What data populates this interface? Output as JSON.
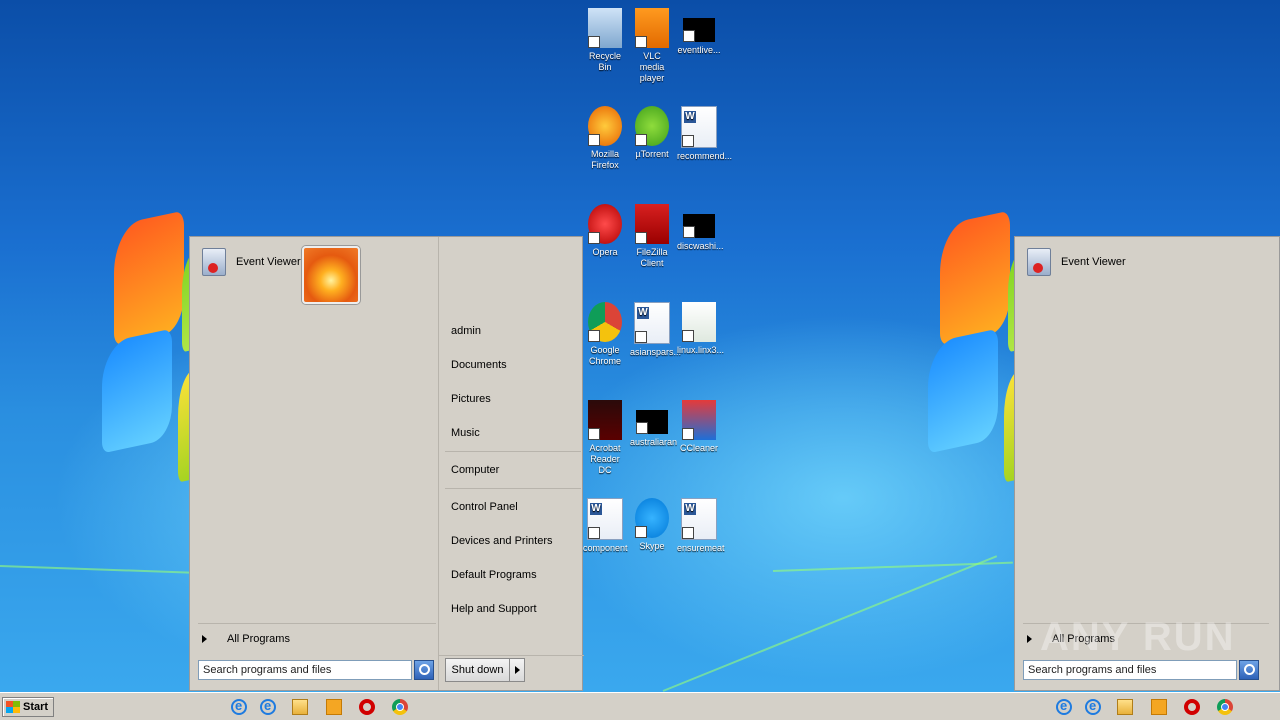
{
  "start_menu": {
    "pinned_program": "Event Viewer",
    "right_items": [
      "admin",
      "Documents",
      "Pictures",
      "Music",
      "Computer",
      "Control Panel",
      "Devices and Printers",
      "Default Programs",
      "Help and Support"
    ],
    "all_programs": "All Programs",
    "search_placeholder": "Search programs and files",
    "shutdown_label": "Shut down"
  },
  "desktop_icons": [
    {
      "label": "Recycle Bin",
      "icon": "recycle-bin-icon"
    },
    {
      "label": "VLC media player",
      "icon": "vlc-icon"
    },
    {
      "label": "eventlive...",
      "icon": "black-file-icon"
    },
    {
      "label": "Mozilla Firefox",
      "icon": "firefox-icon"
    },
    {
      "label": "µTorrent",
      "icon": "utorrent-icon"
    },
    {
      "label": "recommend...",
      "icon": "word-doc-icon"
    },
    {
      "label": "Opera",
      "icon": "opera-icon"
    },
    {
      "label": "FileZilla Client",
      "icon": "filezilla-icon"
    },
    {
      "label": "discwashi...",
      "icon": "black-file-icon"
    },
    {
      "label": "Google Chrome",
      "icon": "chrome-icon"
    },
    {
      "label": "asianspars...",
      "icon": "word-doc-icon"
    },
    {
      "label": "linux.linx3...",
      "icon": "image-file-icon"
    },
    {
      "label": "Acrobat Reader DC",
      "icon": "acrobat-icon"
    },
    {
      "label": "australiaran",
      "icon": "black-file-icon"
    },
    {
      "label": "CCleaner",
      "icon": "ccleaner-icon"
    },
    {
      "label": "component",
      "icon": "word-doc-icon"
    },
    {
      "label": "Skype",
      "icon": "skype-icon"
    },
    {
      "label": "ensuremeat",
      "icon": "word-doc-icon"
    }
  ],
  "right_menu": {
    "pinned_program": "Event Viewer",
    "all_programs": "All Programs",
    "search_placeholder": "Search programs and files"
  },
  "taskbar": {
    "start_label": "Start",
    "apps": [
      "internet-explorer-icon",
      "internet-explorer-icon",
      "explorer-folder-icon",
      "media-player-icon",
      "opera-icon",
      "chrome-icon"
    ]
  },
  "watermark": "ANY RUN",
  "colors": {
    "desktop": "#1a6fd0",
    "menu": "#d4d0c8",
    "taskbar": "#d4d0c8"
  }
}
